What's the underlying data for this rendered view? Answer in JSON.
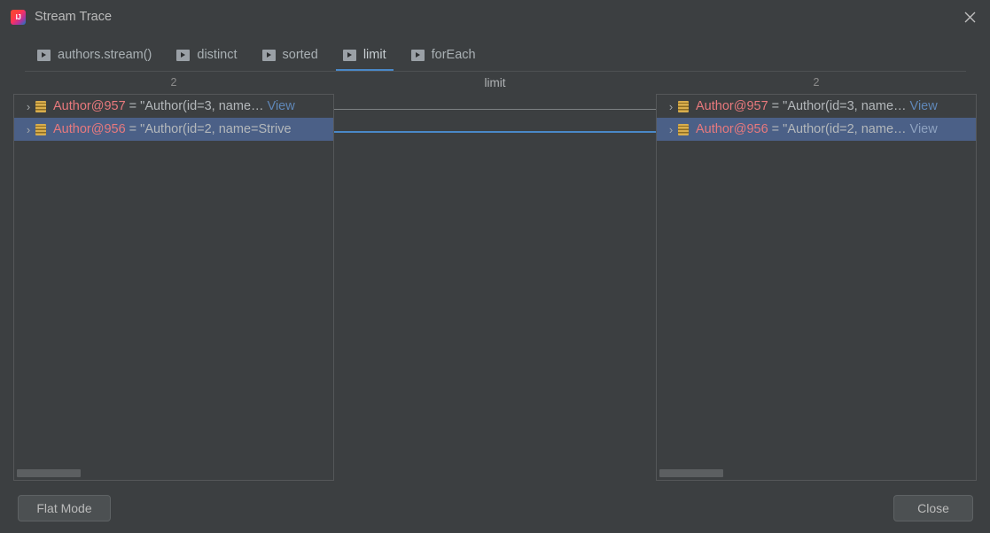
{
  "window": {
    "title": "Stream Trace",
    "app_icon": "intellij-idea-icon",
    "close_icon": "close-icon"
  },
  "tabs": [
    {
      "label": "authors.stream()",
      "icon": "run-arrow-icon",
      "selected": false
    },
    {
      "label": "distinct",
      "icon": "run-arrow-icon",
      "selected": false
    },
    {
      "label": "sorted",
      "icon": "run-arrow-icon",
      "selected": false
    },
    {
      "label": "limit",
      "icon": "run-arrow-icon",
      "selected": true
    },
    {
      "label": "forEach",
      "icon": "run-arrow-icon",
      "selected": false
    }
  ],
  "stage": {
    "name": "limit",
    "before_count": "2",
    "after_count": "2"
  },
  "left_panel": {
    "rows": [
      {
        "chevron": "›",
        "icon": "object-bean-icon",
        "ref": "Author@957",
        "eq": " = ",
        "value": "\"Author(id=3, name… ",
        "link": "View",
        "selected": false
      },
      {
        "chevron": "›",
        "icon": "object-bean-icon",
        "ref": "Author@956",
        "eq": " = ",
        "value": "\"Author(id=2, name=Strive",
        "link": "",
        "selected": true
      }
    ]
  },
  "right_panel": {
    "rows": [
      {
        "chevron": "›",
        "icon": "object-bean-icon",
        "ref": "Author@957",
        "eq": " = ",
        "value": "\"Author(id=3, name… ",
        "link": "View",
        "selected": false
      },
      {
        "chevron": "›",
        "icon": "object-bean-icon",
        "ref": "Author@956",
        "eq": " = ",
        "value": "\"Author(id=2, name… ",
        "link": "View",
        "selected": true
      }
    ]
  },
  "buttons": {
    "flat_mode": "Flat Mode",
    "close": "Close"
  },
  "colors": {
    "background": "#3c3f41",
    "selection": "#4b6087",
    "accent": "#4a88c7",
    "reference": "#e8797d",
    "link": "#5f87b8",
    "bean_icon": "#c49a3f"
  }
}
